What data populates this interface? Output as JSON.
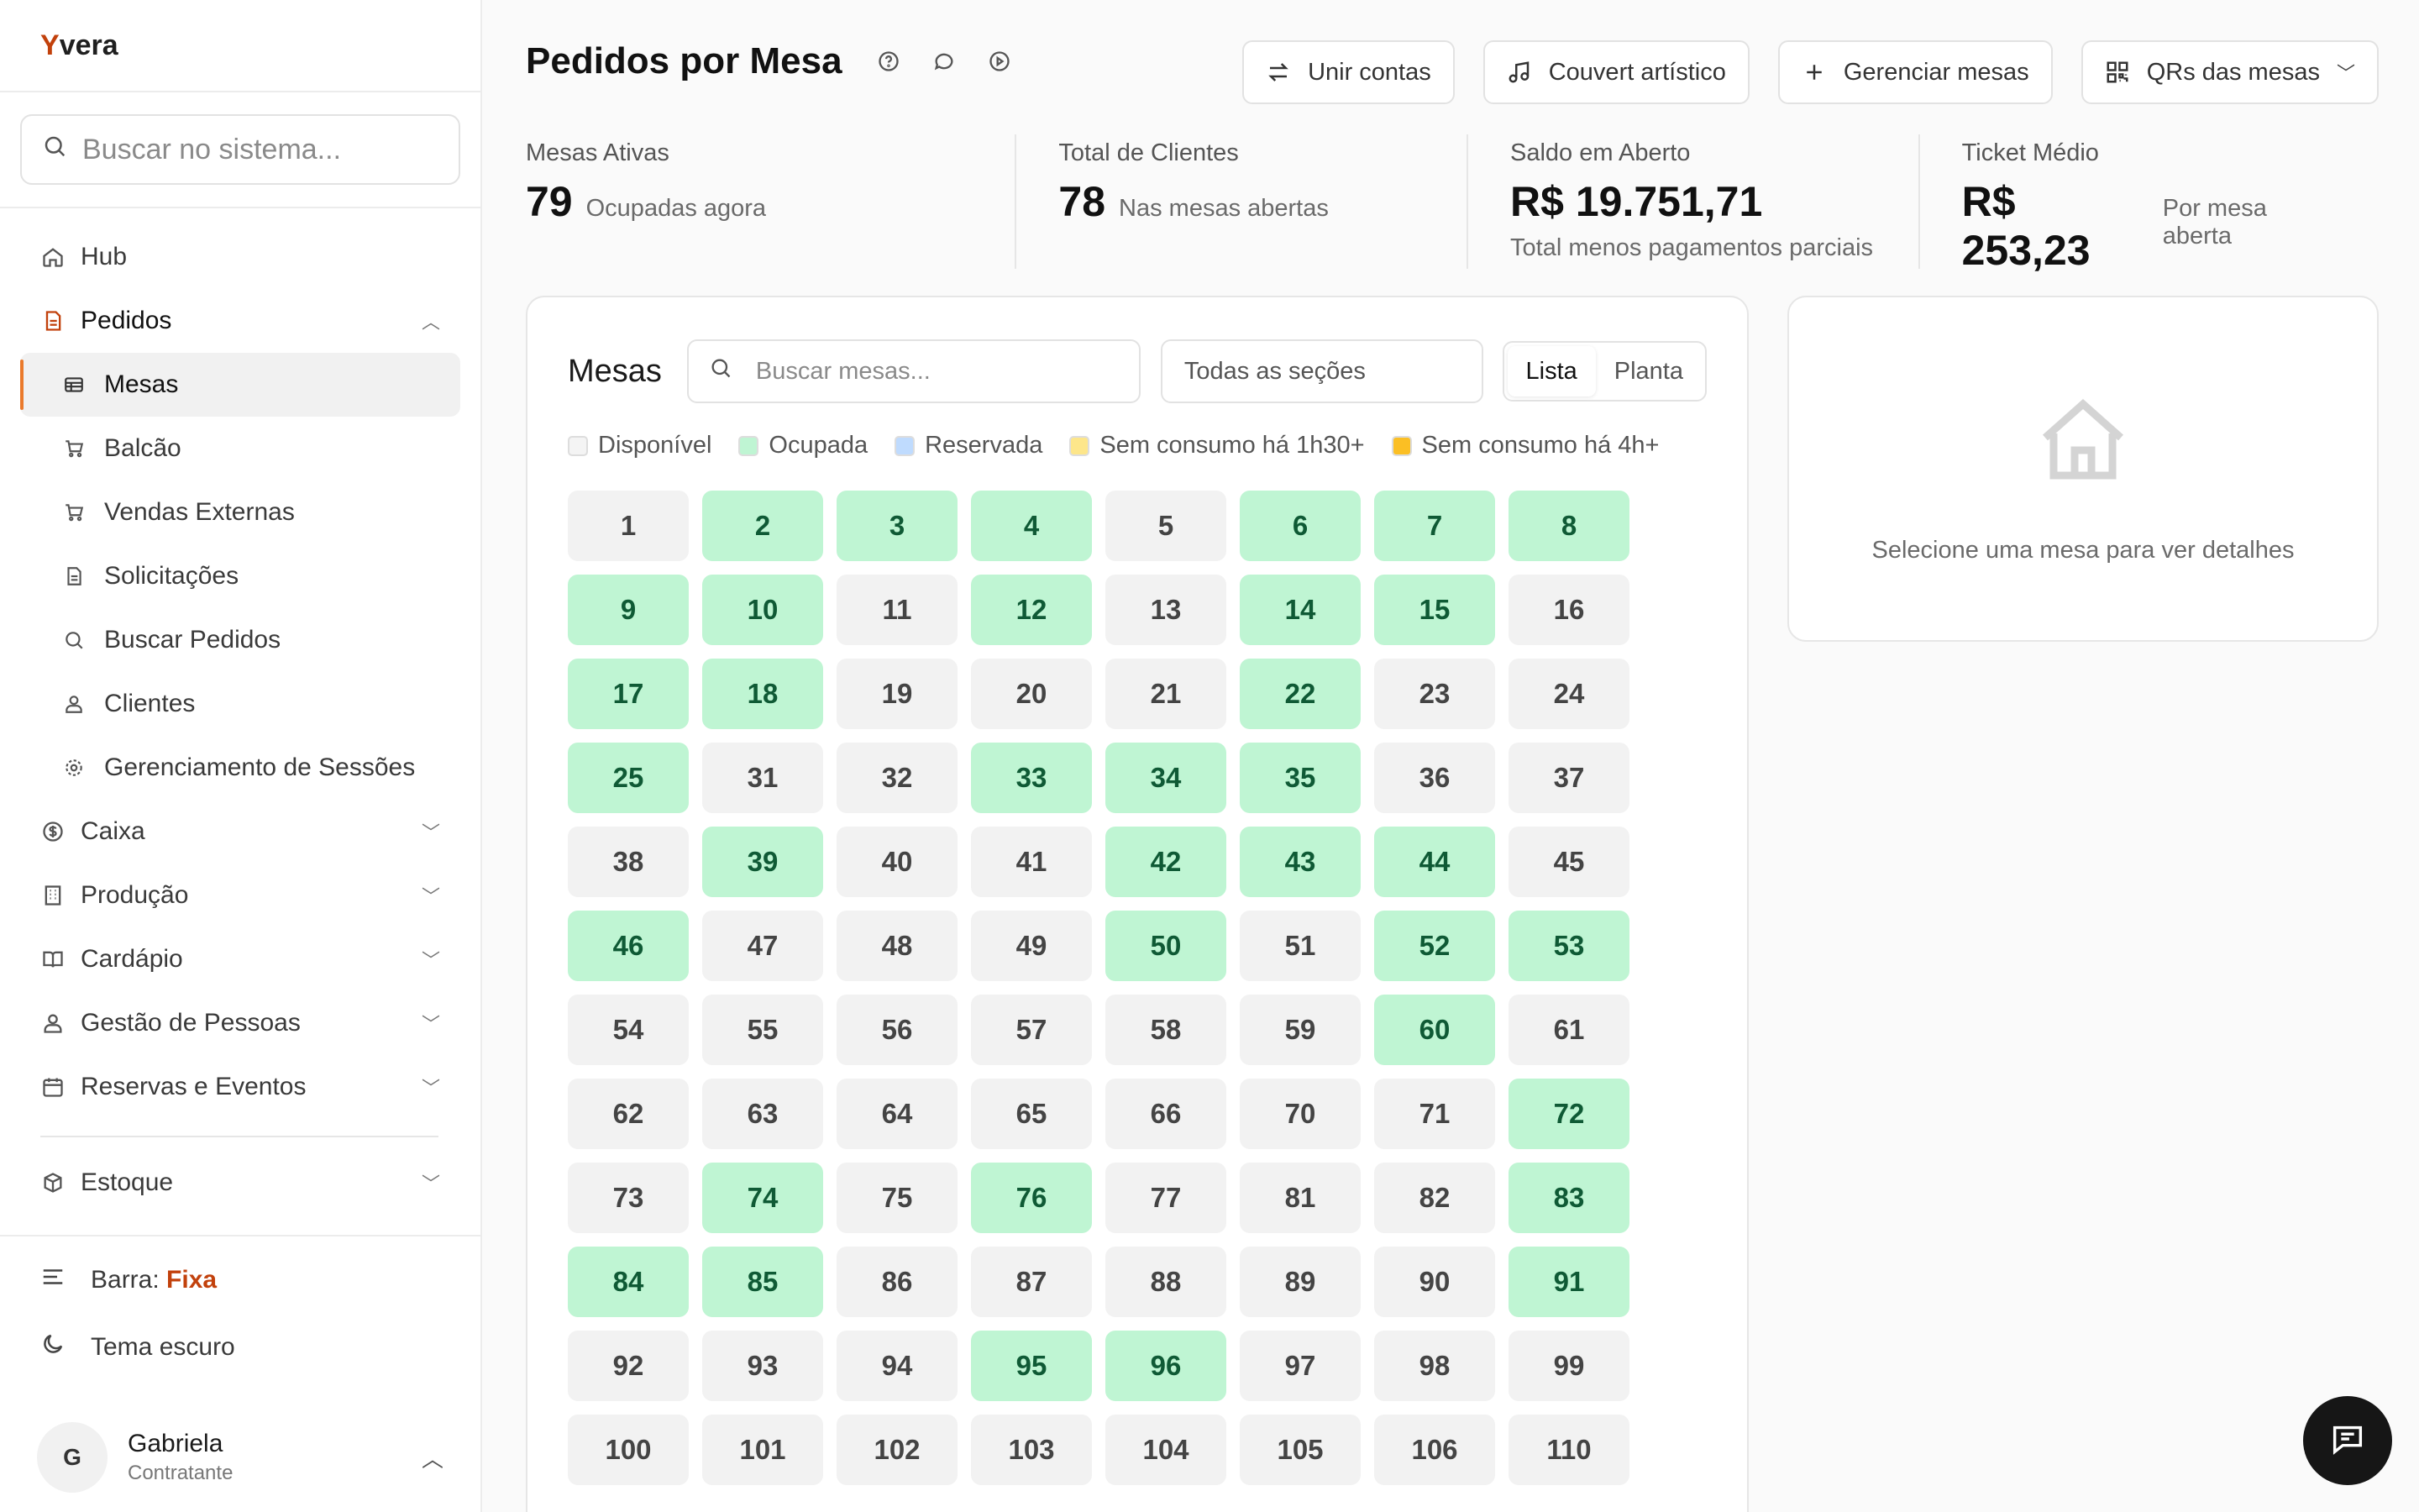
{
  "app": {
    "logo_prefix": "Y",
    "logo_rest": "vera"
  },
  "search": {
    "placeholder": "Buscar no sistema..."
  },
  "sidebar": {
    "items": [
      {
        "label": "Hub"
      },
      {
        "label": "Pedidos"
      },
      {
        "label": "Caixa"
      },
      {
        "label": "Produção"
      },
      {
        "label": "Cardápio"
      },
      {
        "label": "Gestão de Pessoas"
      },
      {
        "label": "Reservas e Eventos"
      },
      {
        "label": "Estoque"
      }
    ],
    "pedidos_sub": [
      {
        "label": "Mesas"
      },
      {
        "label": "Balcão"
      },
      {
        "label": "Vendas Externas"
      },
      {
        "label": "Solicitações"
      },
      {
        "label": "Buscar Pedidos"
      },
      {
        "label": "Clientes"
      },
      {
        "label": "Gerenciamento de Sessões"
      }
    ],
    "bar_label": "Barra:",
    "bar_value": "Fixa",
    "theme_label": "Tema escuro",
    "user": {
      "initial": "G",
      "name": "Gabriela",
      "role": "Contratante"
    }
  },
  "header": {
    "title": "Pedidos por Mesa",
    "actions": {
      "unir": "Unir contas",
      "couvert": "Couvert artístico",
      "gerenciar": "Gerenciar mesas",
      "qrs": "QRs das mesas"
    }
  },
  "stats": {
    "ativas": {
      "label": "Mesas Ativas",
      "value": "79",
      "sub": "Ocupadas agora"
    },
    "clientes": {
      "label": "Total de Clientes",
      "value": "78",
      "sub": "Nas mesas abertas"
    },
    "saldo": {
      "label": "Saldo em Aberto",
      "value": "R$ 19.751,71",
      "sub": "Total menos pagamentos parciais"
    },
    "ticket": {
      "label": "Ticket Médio",
      "value": "R$ 253,23",
      "sub": "Por mesa aberta"
    }
  },
  "mesas": {
    "title": "Mesas",
    "search_placeholder": "Buscar mesas...",
    "section_select": "Todas as seções",
    "view_lista": "Lista",
    "view_planta": "Planta",
    "legend": [
      {
        "label": "Disponível",
        "color": "#f4f4f4"
      },
      {
        "label": "Ocupada",
        "color": "#bff5d3"
      },
      {
        "label": "Reservada",
        "color": "#bfdbfe"
      },
      {
        "label": "Sem consumo há 1h30+",
        "color": "#fde68a"
      },
      {
        "label": "Sem consumo há 4h+",
        "color": "#fbbf24"
      }
    ],
    "tables": [
      {
        "n": "1",
        "s": "free"
      },
      {
        "n": "2",
        "s": "occ"
      },
      {
        "n": "3",
        "s": "occ"
      },
      {
        "n": "4",
        "s": "occ"
      },
      {
        "n": "5",
        "s": "free"
      },
      {
        "n": "6",
        "s": "occ"
      },
      {
        "n": "7",
        "s": "occ"
      },
      {
        "n": "8",
        "s": "occ"
      },
      {
        "n": "9",
        "s": "occ"
      },
      {
        "n": "10",
        "s": "occ"
      },
      {
        "n": "11",
        "s": "free"
      },
      {
        "n": "12",
        "s": "occ"
      },
      {
        "n": "13",
        "s": "free"
      },
      {
        "n": "14",
        "s": "occ"
      },
      {
        "n": "15",
        "s": "occ"
      },
      {
        "n": "16",
        "s": "free"
      },
      {
        "n": "17",
        "s": "occ"
      },
      {
        "n": "18",
        "s": "occ"
      },
      {
        "n": "19",
        "s": "free"
      },
      {
        "n": "20",
        "s": "free"
      },
      {
        "n": "21",
        "s": "free"
      },
      {
        "n": "22",
        "s": "occ"
      },
      {
        "n": "23",
        "s": "free"
      },
      {
        "n": "24",
        "s": "free"
      },
      {
        "n": "25",
        "s": "occ"
      },
      {
        "n": "31",
        "s": "free"
      },
      {
        "n": "32",
        "s": "free"
      },
      {
        "n": "33",
        "s": "occ"
      },
      {
        "n": "34",
        "s": "occ"
      },
      {
        "n": "35",
        "s": "occ"
      },
      {
        "n": "36",
        "s": "free"
      },
      {
        "n": "37",
        "s": "free"
      },
      {
        "n": "38",
        "s": "free"
      },
      {
        "n": "39",
        "s": "occ"
      },
      {
        "n": "40",
        "s": "free"
      },
      {
        "n": "41",
        "s": "free"
      },
      {
        "n": "42",
        "s": "occ"
      },
      {
        "n": "43",
        "s": "occ"
      },
      {
        "n": "44",
        "s": "occ"
      },
      {
        "n": "45",
        "s": "free"
      },
      {
        "n": "46",
        "s": "occ"
      },
      {
        "n": "47",
        "s": "free"
      },
      {
        "n": "48",
        "s": "free"
      },
      {
        "n": "49",
        "s": "free"
      },
      {
        "n": "50",
        "s": "occ"
      },
      {
        "n": "51",
        "s": "free"
      },
      {
        "n": "52",
        "s": "occ"
      },
      {
        "n": "53",
        "s": "occ"
      },
      {
        "n": "54",
        "s": "free"
      },
      {
        "n": "55",
        "s": "free"
      },
      {
        "n": "56",
        "s": "free"
      },
      {
        "n": "57",
        "s": "free"
      },
      {
        "n": "58",
        "s": "free"
      },
      {
        "n": "59",
        "s": "free"
      },
      {
        "n": "60",
        "s": "occ"
      },
      {
        "n": "61",
        "s": "free"
      },
      {
        "n": "62",
        "s": "free"
      },
      {
        "n": "63",
        "s": "free"
      },
      {
        "n": "64",
        "s": "free"
      },
      {
        "n": "65",
        "s": "free"
      },
      {
        "n": "66",
        "s": "free"
      },
      {
        "n": "70",
        "s": "free"
      },
      {
        "n": "71",
        "s": "free"
      },
      {
        "n": "72",
        "s": "occ"
      },
      {
        "n": "73",
        "s": "free"
      },
      {
        "n": "74",
        "s": "occ"
      },
      {
        "n": "75",
        "s": "free"
      },
      {
        "n": "76",
        "s": "occ"
      },
      {
        "n": "77",
        "s": "free"
      },
      {
        "n": "81",
        "s": "free"
      },
      {
        "n": "82",
        "s": "free"
      },
      {
        "n": "83",
        "s": "occ"
      },
      {
        "n": "84",
        "s": "occ"
      },
      {
        "n": "85",
        "s": "occ"
      },
      {
        "n": "86",
        "s": "free"
      },
      {
        "n": "87",
        "s": "free"
      },
      {
        "n": "88",
        "s": "free"
      },
      {
        "n": "89",
        "s": "free"
      },
      {
        "n": "90",
        "s": "free"
      },
      {
        "n": "91",
        "s": "occ"
      },
      {
        "n": "92",
        "s": "free"
      },
      {
        "n": "93",
        "s": "free"
      },
      {
        "n": "94",
        "s": "free"
      },
      {
        "n": "95",
        "s": "occ"
      },
      {
        "n": "96",
        "s": "occ"
      },
      {
        "n": "97",
        "s": "free"
      },
      {
        "n": "98",
        "s": "free"
      },
      {
        "n": "99",
        "s": "free"
      },
      {
        "n": "100",
        "s": "free"
      },
      {
        "n": "101",
        "s": "free"
      },
      {
        "n": "102",
        "s": "free"
      },
      {
        "n": "103",
        "s": "free"
      },
      {
        "n": "104",
        "s": "free"
      },
      {
        "n": "105",
        "s": "free"
      },
      {
        "n": "106",
        "s": "free"
      },
      {
        "n": "110",
        "s": "free"
      }
    ]
  },
  "detail": {
    "empty_text": "Selecione uma mesa para ver detalhes"
  }
}
